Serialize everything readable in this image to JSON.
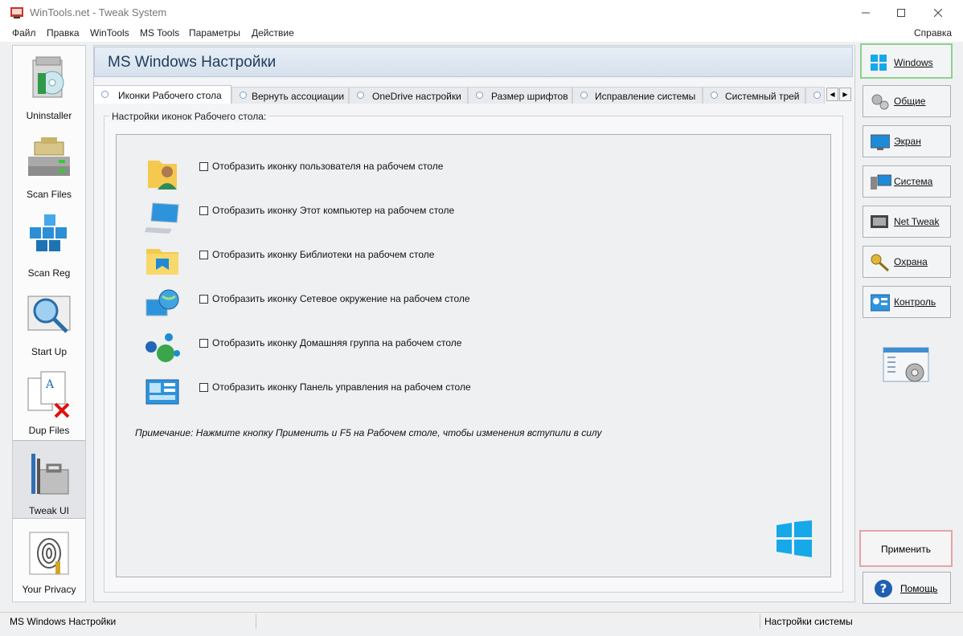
{
  "window": {
    "title": "WinTools.net - Tweak System"
  },
  "menu": [
    "Файл",
    "Правка",
    "WinTools",
    "MS Tools",
    "Параметры",
    "Действие"
  ],
  "menu_help": "Справка",
  "left_nav": [
    {
      "label": "Uninstaller",
      "icon": "uninstaller-icon"
    },
    {
      "label": "Scan Files",
      "icon": "scan-files-icon"
    },
    {
      "label": "Scan Reg",
      "icon": "scan-reg-icon"
    },
    {
      "label": "Start Up",
      "icon": "startup-magnifier-icon"
    },
    {
      "label": "Dup Files",
      "icon": "dup-files-icon"
    },
    {
      "label": "Tweak UI",
      "icon": "tweak-ui-toolbox-icon",
      "active": true
    },
    {
      "label": "Your Privacy",
      "icon": "privacy-fingerprint-icon"
    }
  ],
  "page_title": "MS Windows Настройки",
  "tabs": [
    {
      "label": "Иконки Рабочего стола",
      "active": true
    },
    {
      "label": "Вернуть ассоциации"
    },
    {
      "label": "OneDrive настройки"
    },
    {
      "label": "Размер шрифтов"
    },
    {
      "label": "Исправление системы"
    },
    {
      "label": "Системный трей"
    }
  ],
  "group_title": "Настройки иконок Рабочего стола:",
  "options": [
    {
      "label": "Отобразить иконку пользователя на рабочем столе",
      "icon": "user-folder-icon",
      "checked": false
    },
    {
      "label": "Отобразить иконку Этот компьютер на рабочем столе",
      "icon": "computer-icon",
      "checked": false
    },
    {
      "label": "Отобразить иконку Библиотеки на рабочем столе",
      "icon": "libraries-folder-icon",
      "checked": false
    },
    {
      "label": "Отобразить иконку Сетевое окружение на рабочем столе",
      "icon": "network-globe-icon",
      "checked": false
    },
    {
      "label": "Отобразить иконку Домашняя группа на рабочем столе",
      "icon": "homegroup-icon",
      "checked": false
    },
    {
      "label": "Отобразить иконку Панель управления на рабочем столе",
      "icon": "control-panel-icon",
      "checked": false
    }
  ],
  "note": "Примечание: Нажмите кнопку Применить и F5 на Рабочем столе, чтобы изменения вступили в силу",
  "right_nav": [
    {
      "label": "Windows",
      "icon": "windows-logo-icon",
      "selected": true
    },
    {
      "label": "Общие",
      "icon": "gears-icon"
    },
    {
      "label": "Экран",
      "icon": "monitor-icon"
    },
    {
      "label": "Система",
      "icon": "system-computer-icon"
    },
    {
      "label": "Net Tweak",
      "icon": "net-tweak-icon"
    },
    {
      "label": "Охрана",
      "icon": "security-key-icon"
    },
    {
      "label": "Контроль",
      "icon": "control-icon"
    }
  ],
  "apply_label": "Применить",
  "help_label": "Помощь",
  "status": {
    "left": "MS Windows Настройки",
    "right": "Настройки системы"
  },
  "colors": {
    "accent_blue": "#1f8ad6",
    "windows_logo": "#16a8e8",
    "selected_border": "#8ed08e",
    "apply_border": "#e5a3a8"
  }
}
